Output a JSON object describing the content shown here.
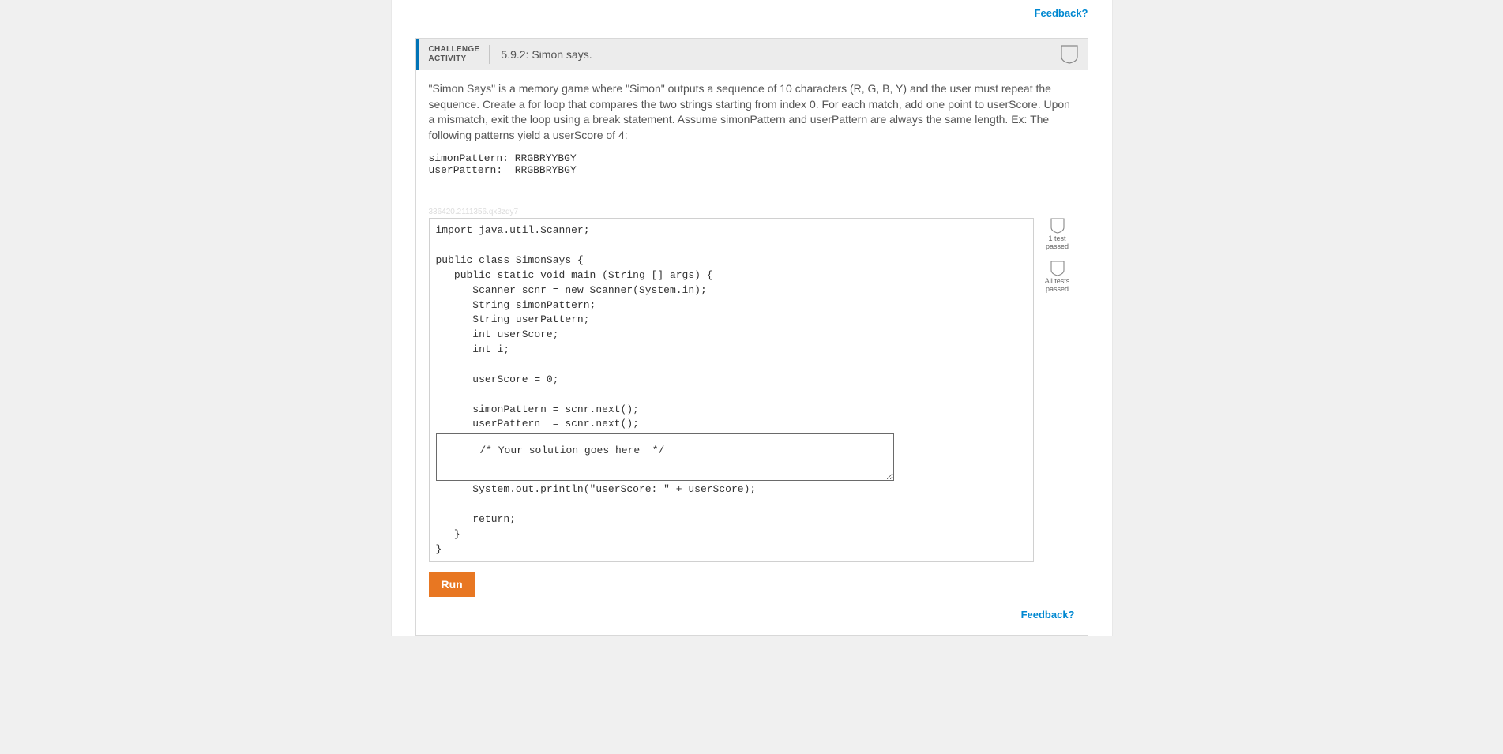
{
  "feedback_link": "Feedback?",
  "challenge": {
    "label_line1": "CHALLENGE",
    "label_line2": "ACTIVITY",
    "number_title": "5.9.2: Simon says.",
    "prompt": "\"Simon Says\" is a memory game where \"Simon\" outputs a sequence of 10 characters (R, G, B, Y) and the user must repeat the sequence. Create a for loop that compares the two strings starting from index 0. For each match, add one point to userScore. Upon a mismatch, exit the loop using a break statement. Assume simonPattern and userPattern are always the same length. Ex: The following patterns yield a userScore of 4:",
    "example": "simonPattern: RRGBRYYBGY\nuserPattern:  RRGBBRYBGY",
    "hash": "336420.2111356.qx3zqy7",
    "code_before": "import java.util.Scanner;\n\npublic class SimonSays {\n   public static void main (String [] args) {\n      Scanner scnr = new Scanner(System.in);\n      String simonPattern;\n      String userPattern;\n      int userScore;\n      int i;\n\n      userScore = 0;\n\n      simonPattern = scnr.next();\n      userPattern  = scnr.next();",
    "solution_placeholder": "      /* Your solution goes here  */",
    "code_after": "      System.out.println(\"userScore: \" + userScore);\n\n      return;\n   }\n}",
    "sidebar": {
      "badge1": "1 test\npassed",
      "badge2": "All tests\npassed"
    },
    "run_label": "Run"
  }
}
